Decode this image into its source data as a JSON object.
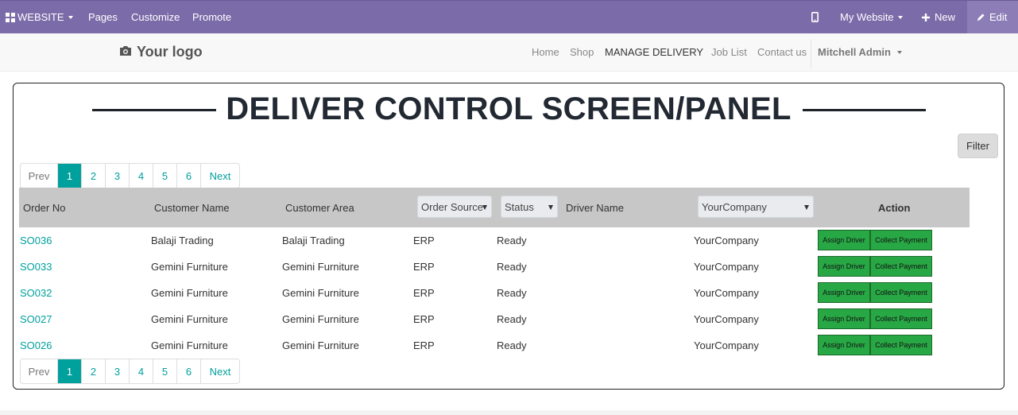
{
  "topbar": {
    "website_label": "WEBSITE",
    "pages_label": "Pages",
    "customize_label": "Customize",
    "promote_label": "Promote",
    "my_website_label": "My Website",
    "new_label": "New",
    "edit_label": "Edit",
    "bg_color": "#7c6ba9"
  },
  "navbar": {
    "logo_text": "Your logo",
    "links": [
      "Home",
      "Shop",
      "MANAGE DELIVERY",
      "Job List",
      "Contact us"
    ],
    "active_link": "MANAGE DELIVERY",
    "user_name": "Mitchell Admin"
  },
  "panel": {
    "title": "DELIVER CONTROL SCREEN/PANEL",
    "filter_label": "Filter"
  },
  "pagination": {
    "prev_label": "Prev",
    "pages": [
      "1",
      "2",
      "3",
      "4",
      "5",
      "6"
    ],
    "current_page": "1",
    "next_label": "Next"
  },
  "table": {
    "headers": {
      "order_no": "Order No",
      "customer_name": "Customer Name",
      "customer_area": "Customer Area",
      "order_source": "Order Source",
      "status": "Status",
      "driver_name": "Driver Name",
      "company": "YourCompany",
      "action": "Action"
    },
    "action_labels": {
      "assign": "Assign Driver",
      "collect": "Collect Payment"
    },
    "rows": [
      {
        "order_no": "SO036",
        "customer_name": "Balaji Trading",
        "customer_area": "Balaji Trading",
        "source": "ERP",
        "status": "Ready",
        "driver": "",
        "company": "YourCompany"
      },
      {
        "order_no": "SO033",
        "customer_name": "Gemini Furniture",
        "customer_area": "Gemini Furniture",
        "source": "ERP",
        "status": "Ready",
        "driver": "",
        "company": "YourCompany"
      },
      {
        "order_no": "SO032",
        "customer_name": "Gemini Furniture",
        "customer_area": "Gemini Furniture",
        "source": "ERP",
        "status": "Ready",
        "driver": "",
        "company": "YourCompany"
      },
      {
        "order_no": "SO027",
        "customer_name": "Gemini Furniture",
        "customer_area": "Gemini Furniture",
        "source": "ERP",
        "status": "Ready",
        "driver": "",
        "company": "YourCompany"
      },
      {
        "order_no": "SO026",
        "customer_name": "Gemini Furniture",
        "customer_area": "Gemini Furniture",
        "source": "ERP",
        "status": "Ready",
        "driver": "",
        "company": "YourCompany"
      }
    ]
  },
  "colors": {
    "accent": "#00a09d",
    "action_button": "#28a745",
    "header_bg": "#c7c7c7"
  }
}
